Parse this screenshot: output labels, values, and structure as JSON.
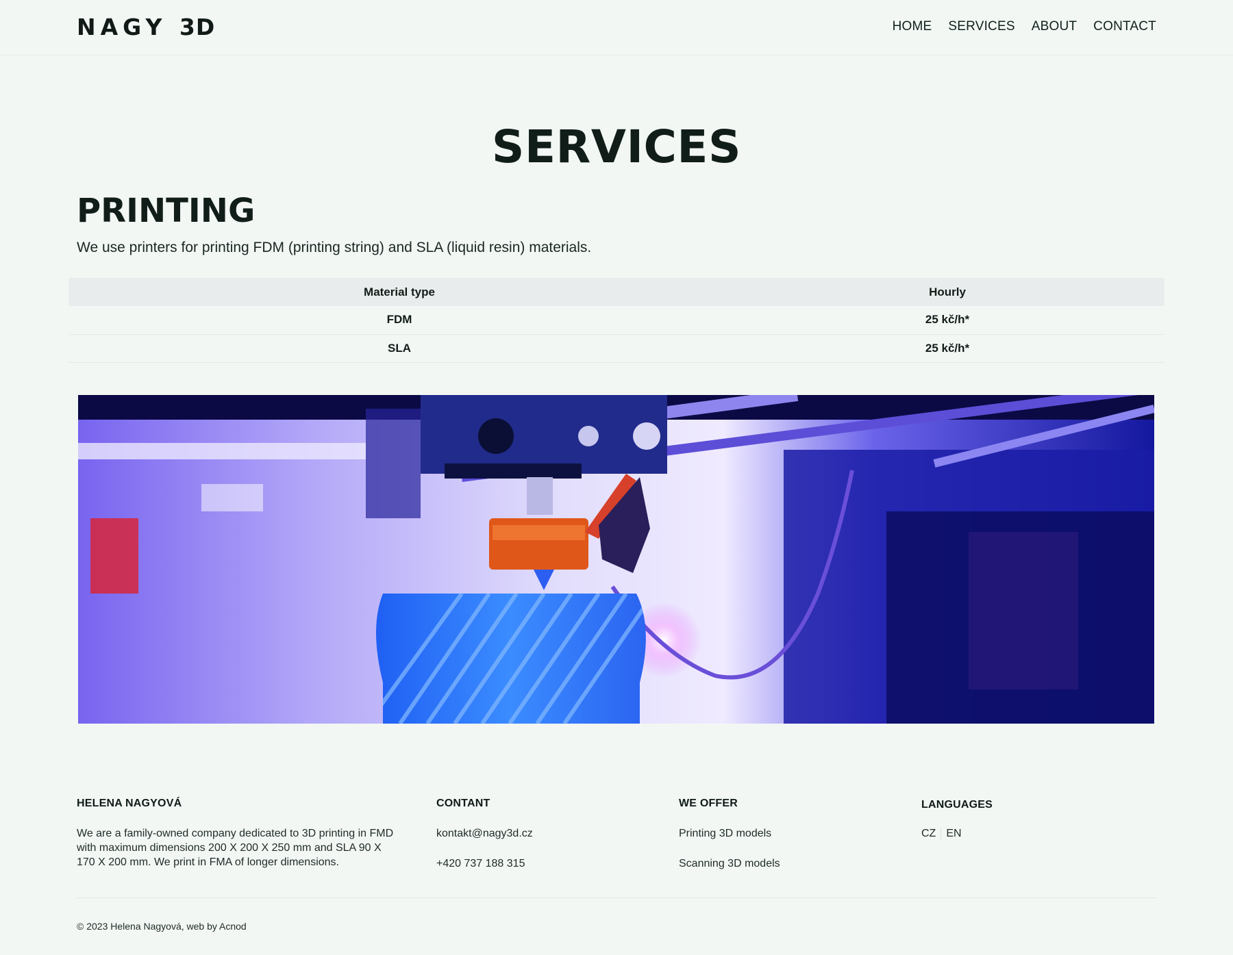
{
  "header": {
    "logo_main": "NAGY",
    "logo_suffix": "3D",
    "nav": [
      {
        "label": "HOME"
      },
      {
        "label": "SERVICES"
      },
      {
        "label": "ABOUT"
      },
      {
        "label": "CONTACT"
      }
    ]
  },
  "main": {
    "page_title": "SERVICES",
    "section_heading": "PRINTING",
    "section_intro": "We use printers for printing FDM (printing string) and SLA (liquid resin) materials.",
    "table": {
      "headers": [
        "Material type",
        "Hourly"
      ],
      "rows": [
        [
          "FDM",
          "25 kč/h*"
        ],
        [
          "SLA",
          "25 kč/h*"
        ]
      ]
    },
    "hero_image": {
      "icon": "3d-printer-photo"
    }
  },
  "footer": {
    "about": {
      "heading": "HELENA NAGYOVÁ",
      "text": "We are a family-owned company dedicated to 3D printing in FMD with maximum dimensions 200 X 200 X 250 mm and SLA 90 X 170 X 200 mm. We print in FMA of longer dimensions."
    },
    "contact": {
      "heading": "CONTANT",
      "email": "kontakt@nagy3d.cz",
      "phone": "+420 737 188 315"
    },
    "offer": {
      "heading": "WE OFFER",
      "items": [
        "Printing 3D models",
        "Scanning 3D models"
      ]
    },
    "languages": {
      "heading": "LANGUAGES",
      "items": [
        "CZ",
        "EN"
      ]
    },
    "copyright": "© 2023 Helena Nagyová, web by Acnod"
  },
  "colors": {
    "background": "#f2f7f4",
    "text": "#111d19",
    "table_header_bg": "#e9ecec"
  }
}
